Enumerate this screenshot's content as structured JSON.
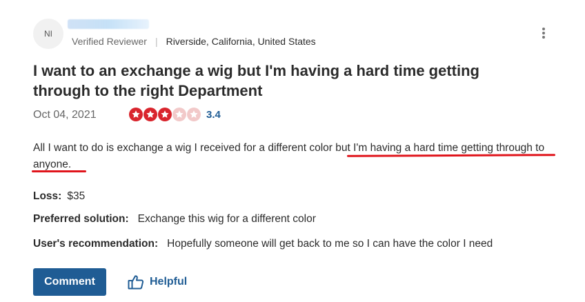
{
  "reviewer": {
    "initials": "NI",
    "verified_label": "Verified Reviewer",
    "separator": "|",
    "location": "Riverside, California, United States"
  },
  "review": {
    "title": "I want to an exchange a wig but I'm having a hard time getting through to the right Department",
    "date": "Oct 04, 2021",
    "rating": "3.4",
    "rating_value": 3,
    "rating_max": 5,
    "body": "All I want to do is exchange a wig I received for a different color but I'm having a hard time getting through to anyone.",
    "loss_label": "Loss:",
    "loss_value": "$35",
    "solution_label": "Preferred solution:",
    "solution_value": "Exchange this wig for a different color",
    "recommendation_label": "User's recommendation:",
    "recommendation_value": "Hopefully someone will get back to me so I can have the color I need"
  },
  "actions": {
    "comment_label": "Comment",
    "helpful_label": "Helpful",
    "more_icon": "more-vertical-icon",
    "helpful_icon": "thumbs-up-icon"
  },
  "colors": {
    "accent": "#1f5c94",
    "star_filled": "#d9252d",
    "star_empty": "#f2c9c9",
    "annotation": "#e0141b"
  }
}
